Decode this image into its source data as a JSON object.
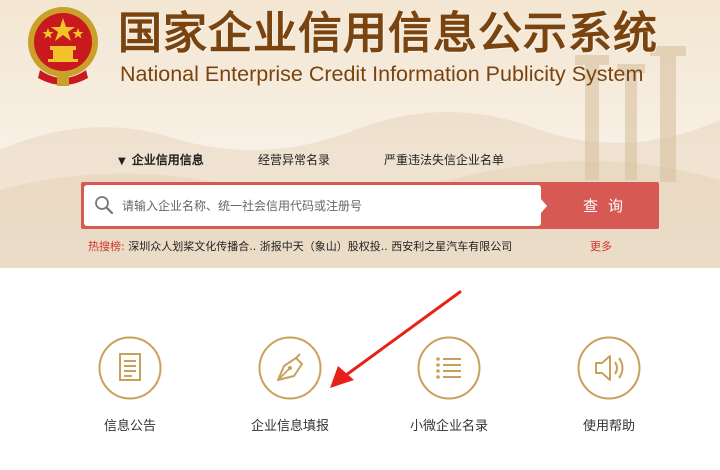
{
  "header": {
    "title_cn": "国家企业信用信息公示系统",
    "title_en": "National Enterprise Credit Information Publicity System",
    "emblem_icon": "national-emblem-icon"
  },
  "nav": {
    "tabs": [
      {
        "label": "企业信用信息",
        "active": true
      },
      {
        "label": "经营异常名录",
        "active": false
      },
      {
        "label": "严重违法失信企业名单",
        "active": false
      }
    ]
  },
  "search": {
    "placeholder": "请输入企业名称、统一社会信用代码或注册号",
    "value": "",
    "button_label": "查询",
    "icon": "search-icon"
  },
  "hot_search": {
    "label": "热搜榜:",
    "items": [
      "深圳众人划桨文化传播合..",
      "浙报中天（象山）股权投..",
      "西安利之星汽车有限公司"
    ],
    "more_label": "更多"
  },
  "services": [
    {
      "label": "信息公告",
      "icon": "document-icon"
    },
    {
      "label": "企业信息填报",
      "icon": "pen-nib-icon"
    },
    {
      "label": "小微企业名录",
      "icon": "list-icon"
    },
    {
      "label": "使用帮助",
      "icon": "speaker-icon"
    }
  ],
  "colors": {
    "brand_brown": "#7a4410",
    "gold": "#c9a05a",
    "search_red": "#d65a53",
    "hot_red": "#d2322d",
    "annotation_arrow": "#e8201a"
  }
}
